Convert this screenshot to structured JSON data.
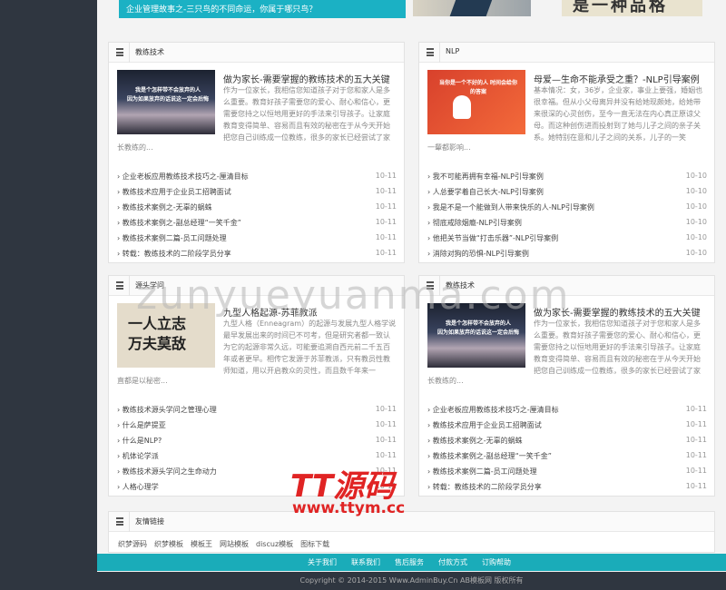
{
  "top": {
    "banner_text": "企业管理故事之-三只鸟的不同命运，你属于哪只鸟？",
    "img2_text": "是一种品格"
  },
  "panels": [
    {
      "title": "教练技术",
      "thumb_caption": "我是个怎样带不会放弃的人\n因为如果放弃的话说这一定会后悔",
      "feat_title": "做为家长-需要掌握的教练技术的五大关键",
      "feat_desc": "作为一位家长，我相信您知道孩子对于您和家人是多么重要。教育好孩子需要您的爱心、耐心和信心，更需要您持之以恒地用更好的手法来引导孩子。让家庭教育变得简单、容易而且有效的秘密在于从今天开始把您自己训练成一位教练，很多的家长已经尝试了家",
      "feat_desc2": "长教练的...",
      "items": [
        {
          "t": "企业老板应用教练技术技巧之-厘清目标",
          "d": "10-11"
        },
        {
          "t": "教练技术应用于企业员工招聘面试",
          "d": "10-11"
        },
        {
          "t": "教练技术案例之-无辜的蜗蛛",
          "d": "10-11"
        },
        {
          "t": "教练技术案例之-副总经理“一笑千金”",
          "d": "10-11"
        },
        {
          "t": "教练技术案例二篇-员工问题处理",
          "d": "10-11"
        },
        {
          "t": "转载：教练技术的二阶段学员分享",
          "d": "10-11"
        }
      ]
    },
    {
      "title": "NLP",
      "thumb_caption": "当你是一个不好的人 时间会给你的答案",
      "feat_title": "母爱—生命不能承受之重？-NLP引导案例",
      "feat_desc": "基本情况：女，36岁，企业家，事业上要强，婚姻也很幸福。但从小父母离异并没有给她现颇她，给她带来很深的心灵创伤，至今一直无法在内心真正原谅父母。而这种创伤进而投射到了她与儿子之间的亲子关系。她特别在意和儿子之间的关系，儿子的一笑",
      "feat_desc2": "一颦都影响...",
      "items": [
        {
          "t": "我不可能再拥有幸福-NLP引导案例",
          "d": "10-10"
        },
        {
          "t": "人总要学着自己长大-NLP引导案例",
          "d": "10-10"
        },
        {
          "t": "我是不是一个能做到人带来快乐的人-NLP引导案例",
          "d": "10-10"
        },
        {
          "t": "彻底戒除烟瘾-NLP引导案例",
          "d": "10-10"
        },
        {
          "t": "他把关节当做“打击乐器”-NLP引导案例",
          "d": "10-10"
        },
        {
          "t": "消除对狗的恐惧-NLP引导案例",
          "d": "10-10"
        }
      ]
    },
    {
      "title": "源头学问",
      "thumb_big": "一人立志\n万夫莫敌",
      "feat_title": "九型人格起源-苏菲教派",
      "feat_desc": "九型人格（Enneagram）的起源与发展九型人格学说最早发展出来的时间已不可考，但是研究者都一致认为它的起源非常久远，可能要追溯自西元前二千五百年或者更早。相传它发源于苏菲教派，只有教员性教师知道，用以开启教众的灵性，而且数千年来一",
      "feat_desc2": "直都是以秘密...",
      "items": [
        {
          "t": "教练技术源头学问之管理心理",
          "d": "10-11"
        },
        {
          "t": "什么是萨提亚",
          "d": "10-11"
        },
        {
          "t": "什么是NLP?",
          "d": "10-11"
        },
        {
          "t": "机体论学派",
          "d": "10-11"
        },
        {
          "t": "教练技术源头学问之生命动力",
          "d": "10-11"
        },
        {
          "t": "人格心理学",
          "d": "10-11"
        }
      ]
    },
    {
      "title": "教练技术",
      "thumb_caption": "我是个怎样带不会放弃的人\n因为如果放弃的话说这一定会后悔",
      "feat_title": "做为家长-需要掌握的教练技术的五大关键",
      "feat_desc": "作为一位家长，我相信您知道孩子对于您和家人是多么重要。教育好孩子需要您的爱心、耐心和信心，更需要您持之以恒地用更好的手法来引导孩子。让家庭教育变得简单、容易而且有效的秘密在于从今天开始把您自己训练成一位教练，很多的家长已经尝试了家",
      "feat_desc2": "长教练的...",
      "items": [
        {
          "t": "企业老板应用教练技术技巧之-厘清目标",
          "d": "10-11"
        },
        {
          "t": "教练技术应用于企业员工招聘面试",
          "d": "10-11"
        },
        {
          "t": "教练技术案例之-无辜的蜗蛛",
          "d": "10-11"
        },
        {
          "t": "教练技术案例之-副总经理“一笑千金”",
          "d": "10-11"
        },
        {
          "t": "教练技术案例二篇-员工问题处理",
          "d": "10-11"
        },
        {
          "t": "转载：教练技术的二阶段学员分享",
          "d": "10-11"
        }
      ]
    }
  ],
  "friends": {
    "title": "友情链接",
    "links": [
      "织梦源码",
      "织梦模板",
      "模板王",
      "网站模板",
      "discuz模板",
      "图标下载"
    ]
  },
  "footer": {
    "nav": [
      "关于我们",
      "联系我们",
      "售后服务",
      "付款方式",
      "订购帮助"
    ],
    "copyright": "Copyright © 2014-2015 Www.AdminBuy.Cn AB模板网 版权所有"
  },
  "overlays": {
    "watermark": "zunyueyuanma.com",
    "logo": "TT源码",
    "url": "www.ttym.cc"
  }
}
